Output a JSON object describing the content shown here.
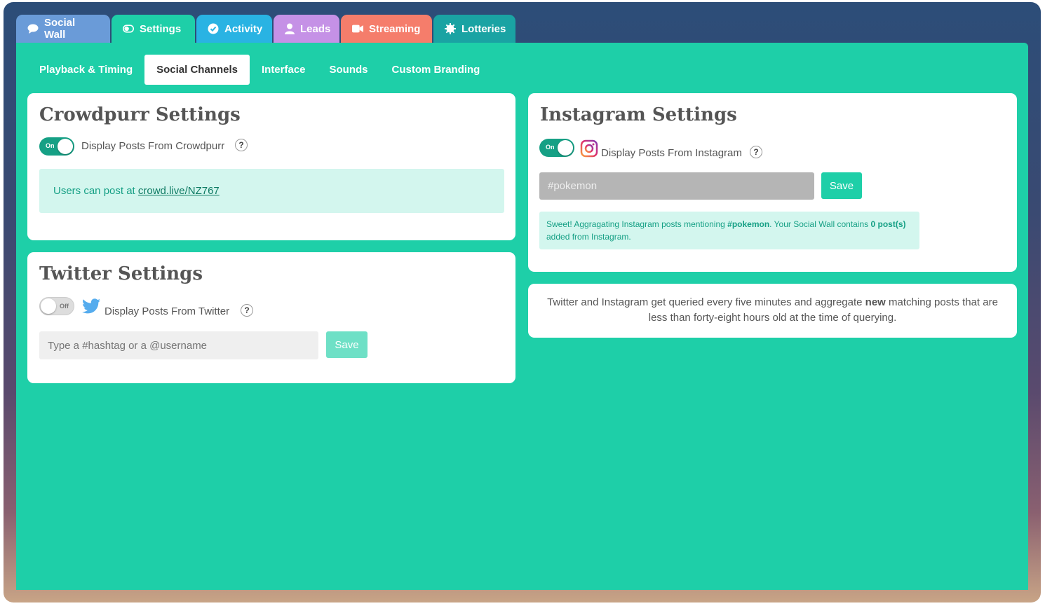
{
  "tabs": [
    {
      "label": "Social Wall",
      "icon": "speech-bubble-icon"
    },
    {
      "label": "Settings",
      "icon": "toggle-icon"
    },
    {
      "label": "Activity",
      "icon": "check-circle-icon"
    },
    {
      "label": "Leads",
      "icon": "user-icon"
    },
    {
      "label": "Streaming",
      "icon": "video-camera-icon"
    },
    {
      "label": "Lotteries",
      "icon": "gear-badge-icon"
    }
  ],
  "subtabs": [
    {
      "label": "Playback & Timing"
    },
    {
      "label": "Social Channels",
      "active": true
    },
    {
      "label": "Interface"
    },
    {
      "label": "Sounds"
    },
    {
      "label": "Custom Branding"
    }
  ],
  "crowdpurr": {
    "title": "Crowdpurr Settings",
    "toggle_label": "On",
    "display_label": "Display Posts From Crowdpurr",
    "help": "?",
    "info_prefix": "Users can post at ",
    "info_link": "crowd.live/NZ767"
  },
  "twitter": {
    "title": "Twitter Settings",
    "toggle_label": "Off",
    "display_label": "Display Posts From Twitter",
    "help": "?",
    "input_placeholder": "Type a #hashtag or a @username",
    "input_value": "",
    "save_label": "Save"
  },
  "instagram": {
    "title": "Instagram Settings",
    "toggle_label": "On",
    "display_label": "Display Posts From Instagram",
    "help": "?",
    "input_value": "#pokemon",
    "save_label": "Save",
    "info_part1": "Sweet! Aggragating Instagram posts mentioning ",
    "info_tag": "#pokemon",
    "info_part2": ". Your Social Wall contains ",
    "info_count": "0 post(s)",
    "info_part3": " added from Instagram."
  },
  "note": {
    "part1": "Twitter and Instagram get queried every five minutes and aggregate ",
    "bold": "new",
    "part2": " matching posts that are less than forty-eight hours old at the time of querying."
  },
  "colors": {
    "accent": "#1ecfa8",
    "toggle_on": "#16a085"
  }
}
